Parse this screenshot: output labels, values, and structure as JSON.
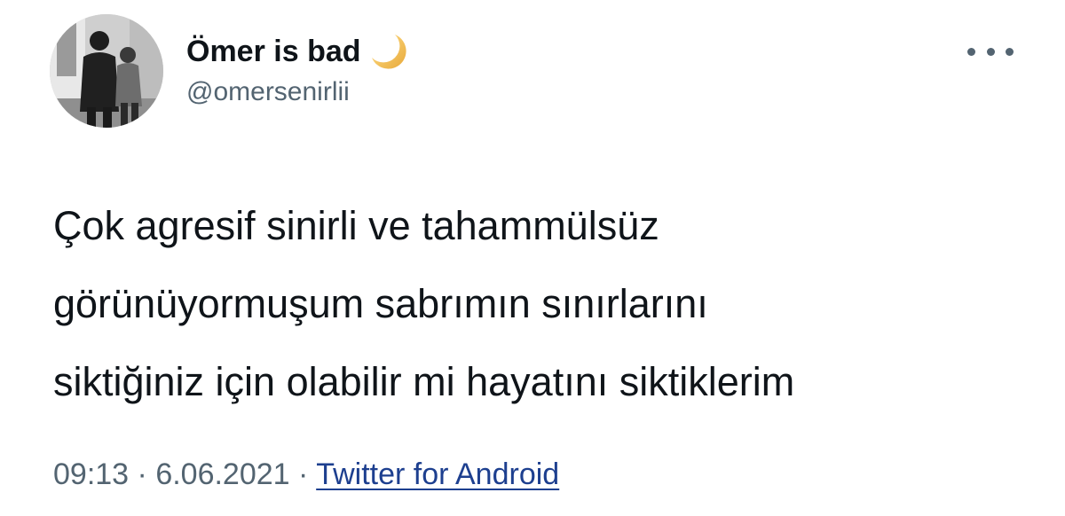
{
  "user": {
    "display_name": "Ömer is bad",
    "name_emoji_icon": "crescent-moon-icon",
    "handle": "@omersenirlii",
    "avatar_icon": "profile-photo"
  },
  "header": {
    "more_icon": "more-options-icon"
  },
  "tweet": {
    "lines": [
      "Çok agresif sinirli ve tahammülsüz",
      "görünüyormuşum sabrımın sınırlarını",
      "siktiğiniz için olabilir mi hayatını siktiklerim"
    ]
  },
  "meta": {
    "time": "09:13",
    "separator1": " · ",
    "date": "6.06.2021",
    "separator2": " · ",
    "source": "Twitter for Android"
  },
  "colors": {
    "text_primary": "#0f1419",
    "text_secondary": "#536471",
    "source_link": "#1d3f8f",
    "moon": "#f2c94c"
  }
}
